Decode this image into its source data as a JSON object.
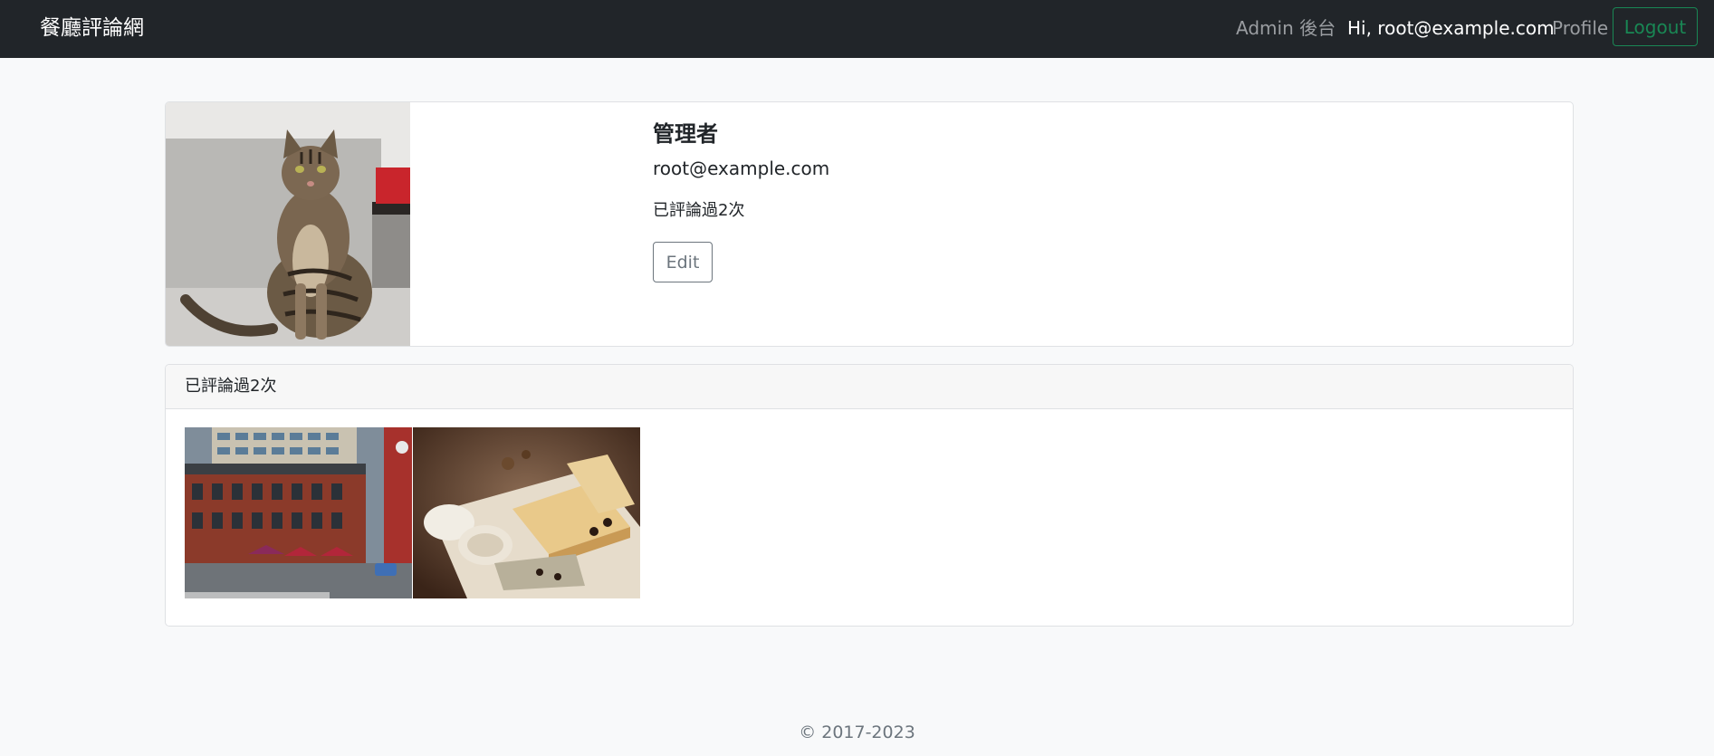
{
  "navbar": {
    "brand": "餐廳評論網",
    "admin_link": "Admin 後台",
    "greeting": "Hi, root@example.com",
    "profile_link": "Profile",
    "logout_label": "Logout"
  },
  "profile": {
    "name": "管理者",
    "email": "root@example.com",
    "comment_count": "已評論過2次",
    "edit_label": "Edit"
  },
  "reviews": {
    "header": "已評論過2次",
    "restaurants": [
      {
        "image": "restaurant-street-photo"
      },
      {
        "image": "cheese-plate-photo"
      }
    ]
  },
  "footer": {
    "copyright": "© 2017-2023"
  },
  "colors": {
    "navbar_bg": "#212529",
    "page_bg": "#f8f9fa",
    "logout_accent": "#198754",
    "muted": "#6c757d"
  }
}
